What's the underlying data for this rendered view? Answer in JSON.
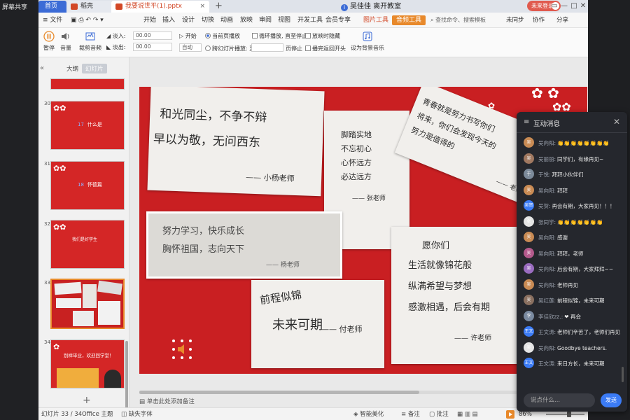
{
  "left_strip": {
    "label": "屏幕共享"
  },
  "tabs": {
    "home": "首页",
    "shell": "稻壳",
    "doc": "我要说世平(1).pptx",
    "add": "+"
  },
  "meeting": {
    "info": "i",
    "text": "吴佳佳 离开教室"
  },
  "login": {
    "label": "未来登录"
  },
  "window_controls": [
    "▭",
    "—",
    "□",
    "✕"
  ],
  "menu": {
    "file": "≡ 文件",
    "items": [
      "开始",
      "插入",
      "设计",
      "切换",
      "动画",
      "放映",
      "审阅",
      "视图",
      "开发工具",
      "会员专享"
    ],
    "picture": "图片工具",
    "record": "音频工具",
    "search": "查找命令、搜索模板",
    "right": [
      "未同步",
      "协作",
      "分享"
    ]
  },
  "ribbon": {
    "pause": "暂停",
    "volume": "音量",
    "crop": "裁剪音频",
    "fade_in": "淡入:",
    "fade_out": "淡出:",
    "fade_in_value": "00.00",
    "fade_out_value": "00.00",
    "start": "开始",
    "start_value": "自动",
    "play_current": "当前页播放",
    "play_cross": "跨幻灯片播放: 至",
    "loop": "循环播放, 直至停止",
    "hide": "放映时隐藏",
    "rewind": "播完返回开头",
    "to_page": "页停止",
    "bg_music": "设为背景音乐"
  },
  "side_panel": {
    "collapse": "«",
    "outline": "大纲",
    "slides": "幻灯片",
    "thumbs": [
      {
        "num": "",
        "cap_num": "",
        "cap": ""
      },
      {
        "num": "30",
        "cap_num": "17",
        "cap": "什么是"
      },
      {
        "num": "31",
        "cap_num": "18",
        "cap": "怀德篇"
      },
      {
        "num": "32",
        "cap_num": "",
        "cap": "我们是好学生"
      },
      {
        "num": "33",
        "cap_num": "",
        "cap": ""
      },
      {
        "num": "34",
        "cap_num": "",
        "cap": "别样毕业，欢迎回学堂！"
      }
    ],
    "add": "+"
  },
  "slide": {
    "card1": {
      "lines": [
        "和光同尘，不争不辩",
        "早以为敬，无问西东"
      ],
      "sig": "小杨老师"
    },
    "card2": {
      "lines": [
        "脚踏实地",
        "不忘初心",
        "心怀远方",
        "必达远方"
      ],
      "sig": "张老师"
    },
    "card3": {
      "lines": [
        "青春就是努力书写你们",
        "将来，你们会发现今天的",
        "努力是值得的"
      ],
      "sig": "老师"
    },
    "card4": {
      "lines": [
        "努力学习，快乐成长",
        "胸怀祖国，志向天下"
      ],
      "sig": "杨老师"
    },
    "card5": {
      "lines": [
        "愿你们",
        "生活就像锦花般",
        "纵满希望与梦想",
        "感激相遇，后会有期"
      ],
      "sig": "许老师"
    },
    "card6": {
      "lines": [
        "前程似锦",
        "未来可期"
      ],
      "sig": "付老师"
    }
  },
  "notes": "单击此处添加备注",
  "status": {
    "slide": "幻灯片 33 / 34",
    "theme": "Office 主题",
    "font": "缺失字体",
    "beautify": "智能美化",
    "notes": "备注",
    "comment": "批注",
    "zoom": "86%",
    "zoom_level": 0.6
  },
  "chat": {
    "title": "互动消息",
    "menu_icon": "≡",
    "close": "✕",
    "messages": [
      {
        "name": "吴向阳:",
        "text": "👏👏👏👏👏👏👏👏",
        "color": "#c98b54",
        "initials": "吴"
      },
      {
        "name": "吴丽丽:",
        "text": "同学们，有缘再见~",
        "color": "#a07860",
        "initials": "吴"
      },
      {
        "name": "于悦:",
        "text": "拜拜小伙伴们",
        "color": "#7c8a9a",
        "initials": "于"
      },
      {
        "name": "吴向阳:",
        "text": "拜拜",
        "color": "#c98b54",
        "initials": "吴"
      },
      {
        "name": "吴贺:",
        "text": "再会有期，大家再见！！！",
        "color": "#3b7bf5",
        "initials": "吴贺"
      },
      {
        "name": "张同学:",
        "text": "👏👏👏👏👏👏👏",
        "color": "#e5e5e5",
        "initials": "张"
      },
      {
        "name": "吴向阳:",
        "text": "感谢",
        "color": "#c98b54",
        "initials": "吴"
      },
      {
        "name": "吴向阳:",
        "text": "拜拜，老师",
        "color": "#b45a8c",
        "initials": "吴"
      },
      {
        "name": "吴向阳:",
        "text": "后会有期，大家拜拜~~",
        "color": "#9a6cc0",
        "initials": "吴"
      },
      {
        "name": "吴向阳:",
        "text": "老师再见",
        "color": "#c98b54",
        "initials": "吴"
      },
      {
        "name": "吴红莲:",
        "text": "前程似锦，未来可期",
        "color": "#8a7060",
        "initials": "吴"
      },
      {
        "name": "李佳欣zz.:",
        "text": "❤ 再会",
        "color": "#7a8aa0",
        "initials": "李"
      },
      {
        "name": "王文涛:",
        "text": "老师们辛苦了，老师们再见",
        "color": "#3b7bf5",
        "initials": "王文"
      },
      {
        "name": "吴向阳:",
        "text": "Goodbye teachers.",
        "color": "#e5e5e5",
        "initials": "吴"
      },
      {
        "name": "王文涛:",
        "text": "来日方长，未来可期",
        "color": "#3b7bf5",
        "initials": "王文"
      }
    ],
    "input_placeholder": "说点什么...",
    "send": "发送"
  }
}
